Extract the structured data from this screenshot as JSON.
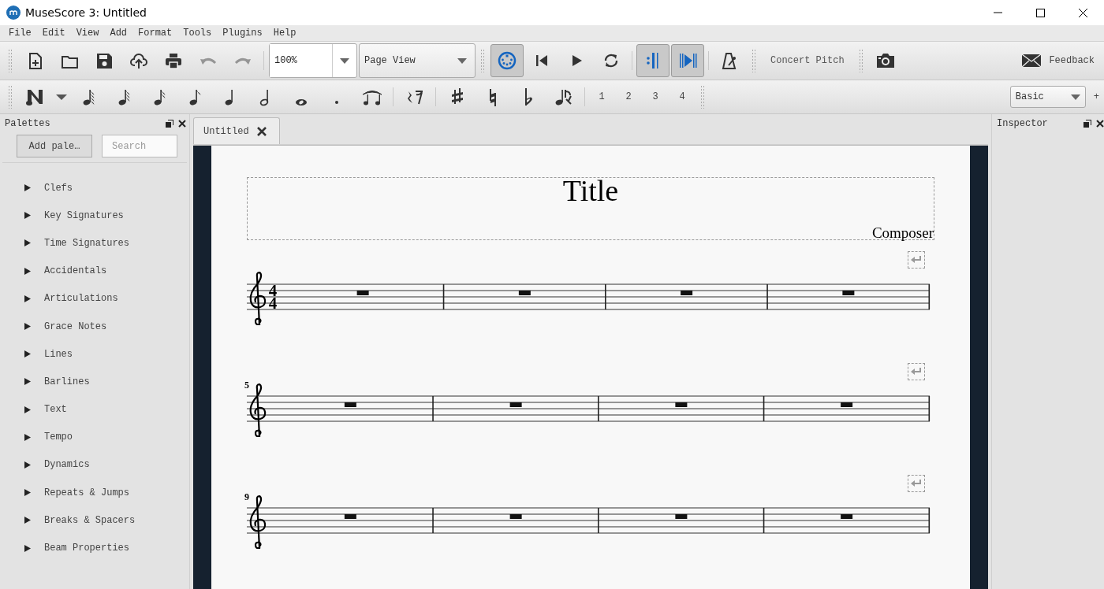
{
  "window": {
    "title": "MuseScore 3: Untitled"
  },
  "menu": [
    "File",
    "Edit",
    "View",
    "Add",
    "Format",
    "Tools",
    "Plugins",
    "Help"
  ],
  "file_toolbar": [
    {
      "kind": "new",
      "disabled": false
    },
    {
      "kind": "open",
      "disabled": false
    },
    {
      "kind": "save",
      "disabled": false
    },
    {
      "kind": "upload",
      "disabled": false
    },
    {
      "kind": "print",
      "disabled": false
    },
    {
      "kind": "undo",
      "disabled": true
    },
    {
      "kind": "redo",
      "disabled": true
    }
  ],
  "zoom": {
    "value": "100%"
  },
  "view_mode": {
    "value": "Page View"
  },
  "playback_toolbar": [
    {
      "kind": "midi",
      "on": true
    },
    {
      "kind": "rewind",
      "on": false
    },
    {
      "kind": "play",
      "on": false
    },
    {
      "kind": "loop",
      "on": false
    },
    {
      "kind": "repeat",
      "on": true
    },
    {
      "kind": "pan",
      "on": true
    },
    {
      "kind": "metronome",
      "on": false
    }
  ],
  "concert_pitch": {
    "label": "Concert Pitch",
    "on": false
  },
  "feedback": {
    "label": "Feedback"
  },
  "note_input_toolbar": [
    {
      "kind": "note-input"
    },
    {
      "kind": "dropdown"
    },
    {
      "kind": "sixtyfourth"
    },
    {
      "kind": "thirtysecond"
    },
    {
      "kind": "sixteenth"
    },
    {
      "kind": "eighth"
    },
    {
      "kind": "quarter"
    },
    {
      "kind": "half"
    },
    {
      "kind": "whole"
    },
    {
      "kind": "dot"
    },
    {
      "kind": "tie"
    },
    {
      "kind": "separator"
    },
    {
      "kind": "rest"
    },
    {
      "kind": "separator"
    },
    {
      "kind": "sharp"
    },
    {
      "kind": "natural"
    },
    {
      "kind": "flat"
    },
    {
      "kind": "flip"
    },
    {
      "kind": "separator"
    }
  ],
  "voices": [
    "1",
    "2",
    "3",
    "4"
  ],
  "workspace": {
    "value": "Basic"
  },
  "add_workspace": "+",
  "palettes": {
    "title": "Palettes",
    "add_button": "Add pale…",
    "search": {
      "placeholder": "Search"
    },
    "items": [
      {
        "label": "Clefs",
        "expanded": false
      },
      {
        "label": "Key Signatures",
        "expanded": false
      },
      {
        "label": "Time Signatures",
        "expanded": false
      },
      {
        "label": "Accidentals",
        "expanded": false
      },
      {
        "label": "Articulations",
        "expanded": false
      },
      {
        "label": "Grace Notes",
        "expanded": false
      },
      {
        "label": "Lines",
        "expanded": false
      },
      {
        "label": "Barlines",
        "expanded": false
      },
      {
        "label": "Text",
        "expanded": false
      },
      {
        "label": "Tempo",
        "expanded": false
      },
      {
        "label": "Dynamics",
        "expanded": false
      },
      {
        "label": "Repeats & Jumps",
        "expanded": false
      },
      {
        "label": "Breaks & Spacers",
        "expanded": false
      },
      {
        "label": "Beam Properties",
        "expanded": false
      }
    ]
  },
  "tabs": [
    {
      "label": "Untitled",
      "selected": true
    }
  ],
  "score": {
    "title": "Title",
    "composer": "Composer",
    "systems": [
      {
        "time_signature": {
          "numerator": "4",
          "denominator": "4"
        },
        "measures": [
          {
            "kind": "whole-rest"
          },
          {
            "kind": "whole-rest"
          },
          {
            "kind": "whole-rest"
          },
          {
            "kind": "whole-rest"
          }
        ]
      },
      {
        "measure_number": "5",
        "measures": [
          {
            "kind": "whole-rest"
          },
          {
            "kind": "whole-rest"
          },
          {
            "kind": "whole-rest"
          },
          {
            "kind": "whole-rest"
          }
        ]
      },
      {
        "measure_number": "9",
        "measures": [
          {
            "kind": "whole-rest"
          },
          {
            "kind": "whole-rest"
          },
          {
            "kind": "whole-rest"
          },
          {
            "kind": "whole-rest"
          }
        ]
      }
    ]
  },
  "inspector": {
    "title": "Inspector"
  }
}
